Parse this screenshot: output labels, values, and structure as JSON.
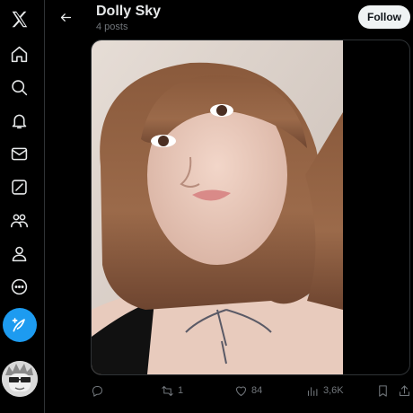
{
  "profile": {
    "name": "Dolly Sky",
    "post_count": "4 posts",
    "follow_label": "Follow"
  },
  "sidebar": {
    "items": [
      {
        "icon": "x-logo-icon"
      },
      {
        "icon": "home-icon"
      },
      {
        "icon": "search-icon"
      },
      {
        "icon": "notifications-icon"
      },
      {
        "icon": "messages-icon"
      },
      {
        "icon": "grok-icon"
      },
      {
        "icon": "communities-icon"
      },
      {
        "icon": "profile-icon"
      },
      {
        "icon": "more-icon"
      }
    ],
    "compose_icon": "compose-post-icon"
  },
  "post": {
    "actions": {
      "reply_count": "",
      "repost_count": "1",
      "like_count": "84",
      "views_count": "3,6K"
    }
  },
  "colors": {
    "background": "#000000",
    "accent": "#1d9bf0",
    "text_primary": "#e7e9ea",
    "text_secondary": "#71767b",
    "border": "#2f3336"
  }
}
